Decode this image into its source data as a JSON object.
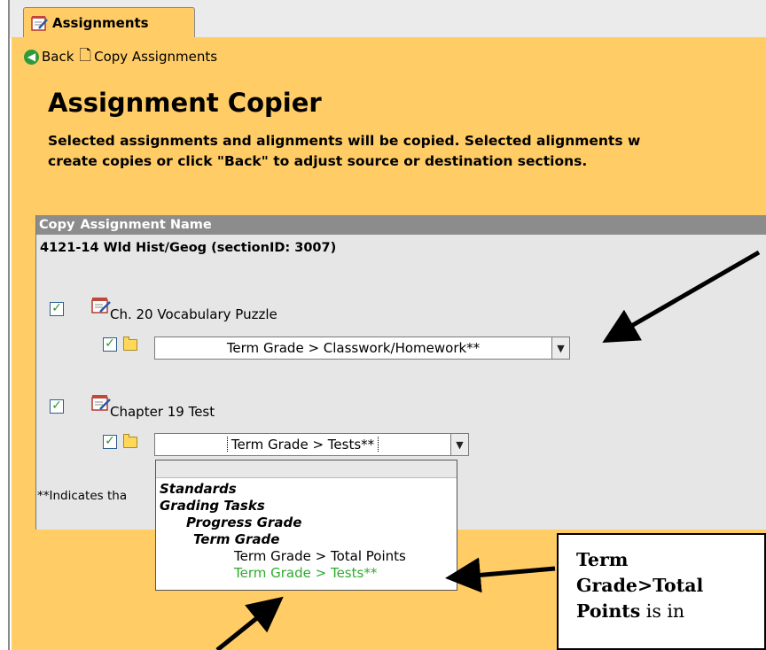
{
  "tab": {
    "label": "Assignments",
    "icon": "assignment-icon"
  },
  "toolbar": {
    "back_label": "Back",
    "copy_label": "Copy Assignments"
  },
  "page": {
    "title": "Assignment Copier",
    "description_line1": "Selected assignments and alignments will be copied. Selected alignments w",
    "description_line2": "create copies or click \"Back\" to adjust source or destination sections."
  },
  "table": {
    "col_copy": "Copy",
    "col_name": "Assignment Name",
    "section": "4121-14 Wld Hist/Geog (sectionID: 3007)",
    "assignments": [
      {
        "name": "Ch. 20 Vocabulary Puzzle",
        "checked": true,
        "alignment_checked": true,
        "alignment": "Term Grade > Classwork/Homework**"
      },
      {
        "name": "Chapter 19 Test",
        "checked": true,
        "alignment_checked": true,
        "alignment": "Term Grade > Tests**"
      }
    ],
    "footnote": "**Indicates tha"
  },
  "dropdown": {
    "groups": [
      "Standards",
      "Grading Tasks",
      "Progress Grade",
      "Term Grade"
    ],
    "options": [
      "Term Grade > Total Points",
      "Term Grade > Tests**"
    ]
  },
  "callout": {
    "bold1": "Term",
    "bold2": "Grade>Total",
    "bold3": "Points",
    "rest": " is in"
  },
  "colors": {
    "background": "#ffcc66",
    "panel": "#e6e6e6",
    "header": "#8c8c8c",
    "green_option": "#2eab2e"
  }
}
